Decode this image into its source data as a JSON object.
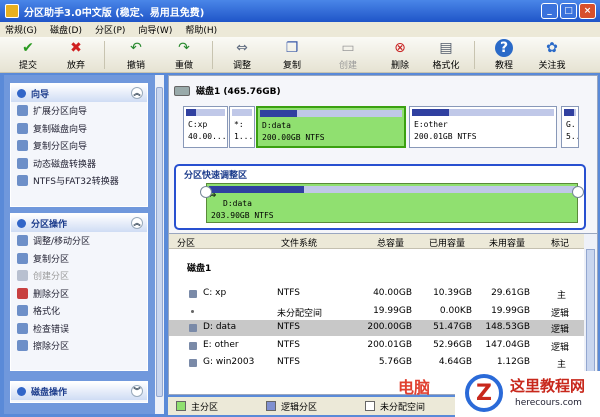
{
  "window": {
    "title": "分区助手3.0中文版 (稳定、易用且免费)"
  },
  "menu": [
    "常规(G)",
    "磁盘(D)",
    "分区(P)",
    "向导(W)",
    "帮助(H)"
  ],
  "toolbar": [
    {
      "label": "提交",
      "icon": "check-icon"
    },
    {
      "label": "放弃",
      "icon": "x-icon"
    },
    {
      "label": "撤销",
      "icon": "undo-icon"
    },
    {
      "label": "重做",
      "icon": "redo-icon"
    },
    {
      "label": "调整",
      "icon": "resize-icon"
    },
    {
      "label": "复制",
      "icon": "copy-icon"
    },
    {
      "label": "创建",
      "icon": "create-icon",
      "disabled": true
    },
    {
      "label": "删除",
      "icon": "delete-icon"
    },
    {
      "label": "格式化",
      "icon": "format-icon"
    },
    {
      "label": "教程",
      "icon": "help-icon"
    },
    {
      "label": "关注我",
      "icon": "follow-icon"
    }
  ],
  "sidebar": {
    "wizard": {
      "title": "向导",
      "items": [
        "扩展分区向导",
        "复制磁盘向导",
        "复制分区向导",
        "动态磁盘转换器",
        "NTFS与FAT32转换器"
      ]
    },
    "partition_ops": {
      "title": "分区操作",
      "items": [
        {
          "label": "调整/移动分区"
        },
        {
          "label": "复制分区"
        },
        {
          "label": "创建分区",
          "disabled": true
        },
        {
          "label": "删除分区"
        },
        {
          "label": "格式化"
        },
        {
          "label": "检查错误"
        },
        {
          "label": "擦除分区"
        }
      ]
    },
    "disk_ops": {
      "title": "磁盘操作"
    }
  },
  "disk": {
    "header": "磁盘1 (465.76GB)",
    "partitions": [
      {
        "name": "C:xp",
        "info": "40.00...",
        "used_fraction": 0.26
      },
      {
        "name": "*:",
        "info": "1...",
        "used_fraction": 0.0
      },
      {
        "name": "D:data",
        "info": "200.00GB NTFS",
        "used_fraction": 0.26,
        "selected": true
      },
      {
        "name": "E:other",
        "info": "200.01GB NTFS",
        "used_fraction": 0.26
      },
      {
        "name": "G.",
        "info": "5...",
        "used_fraction": 0.8
      }
    ]
  },
  "quick_resize": {
    "title": "分区快速调整区",
    "name": "D:data",
    "info": "203.90GB NTFS",
    "used_fraction": 0.26
  },
  "table": {
    "headers": [
      "分区",
      "文件系统",
      "总容量",
      "已用容量",
      "未用容量",
      "标记"
    ],
    "group": "磁盘1",
    "rows": [
      {
        "part": "C:  xp",
        "fs": "NTFS",
        "total": "40.00GB",
        "used": "10.39GB",
        "free": "29.61GB",
        "flag": "主"
      },
      {
        "part": "*",
        "fs": "未分配空间",
        "total": "19.99GB",
        "used": "0.00KB",
        "free": "19.99GB",
        "flag": "逻辑"
      },
      {
        "part": "D:  data",
        "fs": "NTFS",
        "total": "200.00GB",
        "used": "51.47GB",
        "free": "148.53GB",
        "flag": "逻辑",
        "selected": true
      },
      {
        "part": "E:  other",
        "fs": "NTFS",
        "total": "200.01GB",
        "used": "52.96GB",
        "free": "147.04GB",
        "flag": "逻辑"
      },
      {
        "part": "G:  win2003",
        "fs": "NTFS",
        "total": "5.76GB",
        "used": "4.64GB",
        "free": "1.12GB",
        "flag": "主"
      }
    ]
  },
  "legend": [
    {
      "label": "主分区",
      "color": "#90e070"
    },
    {
      "label": "逻辑分区",
      "color": "#8090d0"
    },
    {
      "label": "未分配空间",
      "color": "#ffffff"
    }
  ],
  "watermark": {
    "title": "这里教程网",
    "url": "herecours.com",
    "logo": "Z",
    "red_text": "电脑"
  }
}
